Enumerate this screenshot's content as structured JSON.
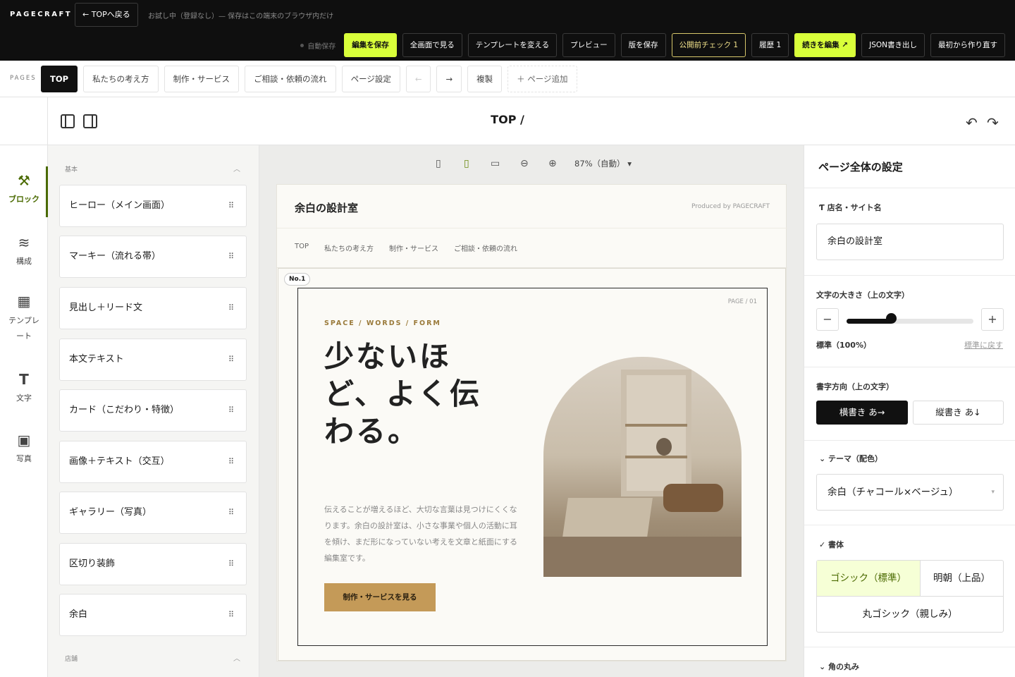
{
  "app": {
    "brand": "PAGECRAFT",
    "back_label": "← TOPへ戻る",
    "trial_text": "お試し中（登録なし）— 保存はこの端末のブラウザ内だけ",
    "autosave": "自動保存",
    "toolbar": [
      "編集を保存",
      "全画面で見る",
      "テンプレートを変える",
      "プレビュー",
      "版を保存",
      "公開前チェック 1",
      "履歴 1",
      "続きを編集 ↗",
      "JSON書き出し",
      "最初から作り直す"
    ]
  },
  "pages": {
    "label": "PAGES",
    "tabs": [
      "TOP",
      "私たちの考え方",
      "制作・サービス",
      "ご相談・依頼の流れ",
      "ページ設定"
    ],
    "prev": "←",
    "next": "→",
    "duplicate": "複製",
    "add": "＋ ページ追加"
  },
  "context": {
    "title": "TOP /",
    "undo": "↶",
    "redo": "↷"
  },
  "left_nav": [
    {
      "label": "ブロック",
      "icon": "hammer-icon",
      "glyph": "⚒"
    },
    {
      "label": "構成",
      "icon": "layers-icon",
      "glyph": "≋"
    },
    {
      "label": "テンプレート",
      "icon": "grid-icon",
      "glyph": "▦"
    },
    {
      "label": "文字",
      "icon": "text-icon",
      "glyph": "T"
    },
    {
      "label": "写真",
      "icon": "photo-icon",
      "glyph": "▣"
    }
  ],
  "blocks": {
    "section_basic": "基本",
    "items": [
      "ヒーロー（メイン画面）",
      "マーキー（流れる帯）",
      "見出し＋リード文",
      "本文テキスト",
      "カード（こだわり・特徴）",
      "画像＋テキスト（交互）",
      "ギャラリー（写真）",
      "区切り装飾",
      "余白"
    ],
    "section_shop": "店舗",
    "grip": "⠿"
  },
  "canvas": {
    "zoom": "87%（自動）",
    "site_name": "余白の設計室",
    "produced_by": "Produced by PAGECRAFT",
    "nav": [
      "TOP",
      "私たちの考え方",
      "制作・サービス",
      "ご相談・依頼の流れ"
    ],
    "badge": "No.1",
    "page_no": "PAGE / 01",
    "eyebrow": "SPACE / WORDS / FORM",
    "headline": "少ないほど、よく伝わる。",
    "paragraph": "伝えることが増えるほど、大切な言葉は見つけにくくなります。余白の設計室は、小さな事業や個人の活動に耳を傾け、まだ形になっていない考えを文章と紙面にする編集室です。",
    "cta": "制作・サービスを見る"
  },
  "right_panel": {
    "title": "ページ全体の設定",
    "shop_name_label": "店名・サイト名",
    "shop_name_value": "余白の設計室",
    "font_size_label": "文字の大きさ（上の文字）",
    "font_size_fraction": 0.35,
    "font_size_status": "標準（100%）",
    "reset": "標準に戻す",
    "direction_label": "書字方向（上の文字）",
    "direction_options": [
      "横書き あ→",
      "縦書き あ↓"
    ],
    "theme_label": "テーマ（配色）",
    "theme_value": "余白（チャコール×ベージュ）",
    "font_label": "書体",
    "font_options": [
      "ゴシック（標準）",
      "明朝（上品）",
      "丸ゴシック（親しみ）"
    ],
    "corner_label": "角の丸み"
  },
  "colors": {
    "accent_lime": "#d9ff3a",
    "cta_gold": "#c49a58",
    "active_green": "#4a6a00"
  }
}
